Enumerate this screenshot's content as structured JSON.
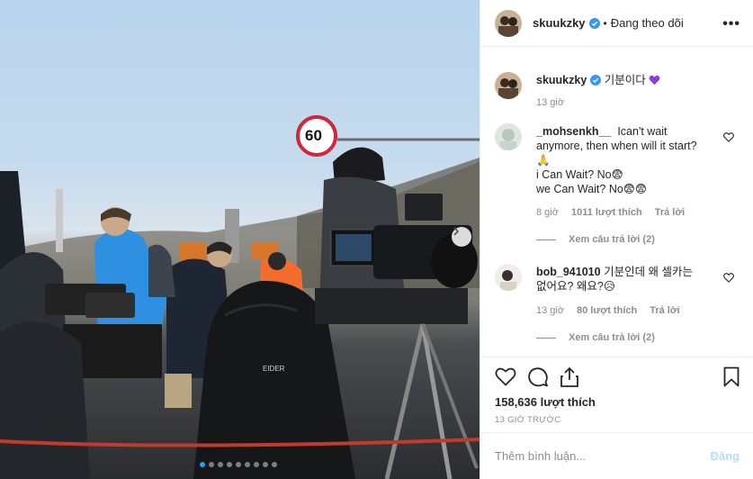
{
  "post": {
    "username": "skuukzky",
    "separator": "•",
    "follow_status": "Đang theo dõi",
    "more": "•••",
    "sign_number": "60",
    "carousel_dots": 9
  },
  "caption": {
    "username": "skuukzky",
    "text": "기분이다",
    "time": "13 giờ"
  },
  "comments": [
    {
      "username": "_mohsenkh__",
      "lines": [
        "Ican't wait",
        "anymore, then when will it start?",
        "🙏",
        "i Can Wait? No😨",
        "we Can Wait? No😨😨"
      ],
      "time": "8 giờ",
      "likes": "1011 lượt thích",
      "reply": "Trả lời",
      "view_replies": "Xem câu trả lời (2)"
    },
    {
      "username": "bob_941010",
      "lines": [
        "기분인데 왜 셀카는",
        "없어요? 왜요?😥"
      ],
      "time": "13 giờ",
      "likes": "80 lượt thích",
      "reply": "Trả lời",
      "view_replies": "Xem câu trả lời (2)"
    }
  ],
  "stats": {
    "likes": "158,636 lượt thích",
    "time": "13 GIỜ TRƯỚC"
  },
  "add_comment": {
    "placeholder": "Thêm bình luận...",
    "post_label": "Đăng"
  },
  "colors": {
    "accent": "#0095f6",
    "verified": "#3897f0",
    "post_disabled": "#b2dffc",
    "muted": "#8e8e8e"
  }
}
